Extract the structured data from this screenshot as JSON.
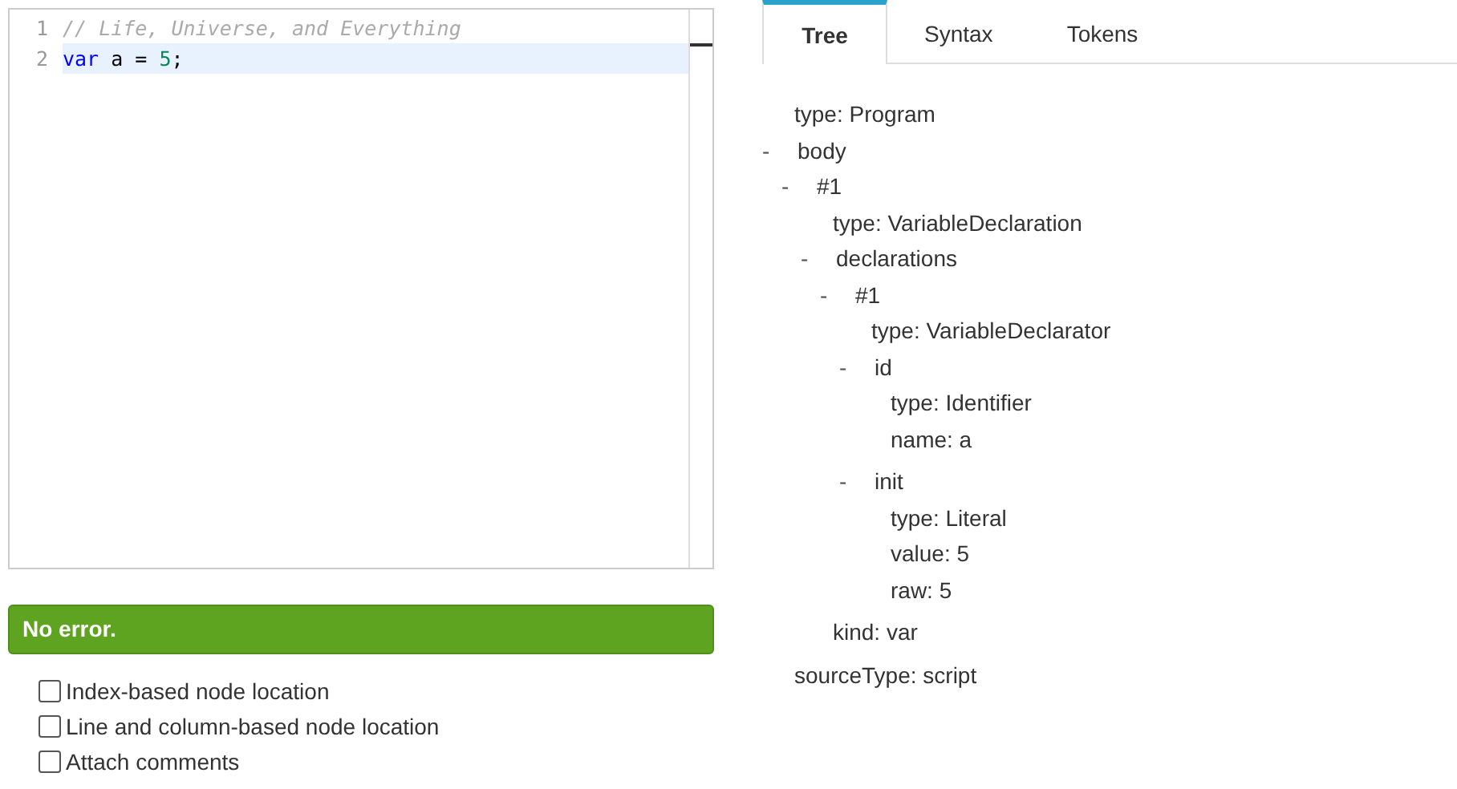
{
  "editor": {
    "lines": [
      {
        "number": "1",
        "active": false,
        "tokens": [
          {
            "kind": "comment",
            "text": "// Life, Universe, and Everything"
          }
        ]
      },
      {
        "number": "2",
        "active": true,
        "tokens": [
          {
            "kind": "keyword",
            "text": "var"
          },
          {
            "kind": "plain",
            "text": " a = "
          },
          {
            "kind": "number",
            "text": "5"
          },
          {
            "kind": "plain",
            "text": ";"
          }
        ]
      }
    ]
  },
  "status": {
    "kind": "ok",
    "text": "No error."
  },
  "options": [
    {
      "label": "Index-based node location",
      "checked": false
    },
    {
      "label": "Line and column-based node location",
      "checked": false
    },
    {
      "label": "Attach comments",
      "checked": false
    }
  ],
  "tabs": [
    {
      "label": "Tree",
      "selected": true
    },
    {
      "label": "Syntax",
      "selected": false
    },
    {
      "label": "Tokens",
      "selected": false
    }
  ],
  "tree": [
    {
      "kind": "prop",
      "text": "type: Program"
    },
    {
      "kind": "group",
      "toggle": "-",
      "label": "body",
      "expanded": true,
      "children": [
        {
          "kind": "group",
          "toggle": "-",
          "label": "#1",
          "expanded": true,
          "children": [
            {
              "kind": "prop",
              "text": "type: VariableDeclaration"
            },
            {
              "kind": "group",
              "toggle": "-",
              "label": "declarations",
              "expanded": true,
              "children": [
                {
                  "kind": "group",
                  "toggle": "-",
                  "label": "#1",
                  "expanded": true,
                  "children": [
                    {
                      "kind": "prop",
                      "text": "type: VariableDeclarator"
                    },
                    {
                      "kind": "group",
                      "toggle": "-",
                      "label": "id",
                      "expanded": true,
                      "children": [
                        {
                          "kind": "prop",
                          "text": "type: Identifier"
                        },
                        {
                          "kind": "prop",
                          "text": "name: a"
                        }
                      ]
                    },
                    {
                      "kind": "group",
                      "toggle": "-",
                      "label": "init",
                      "expanded": true,
                      "children": [
                        {
                          "kind": "prop",
                          "text": "type: Literal"
                        },
                        {
                          "kind": "prop",
                          "text": "value: 5"
                        },
                        {
                          "kind": "prop",
                          "text": "raw: 5"
                        }
                      ]
                    }
                  ]
                }
              ]
            },
            {
              "kind": "prop",
              "text": "kind: var"
            }
          ]
        }
      ]
    },
    {
      "kind": "prop",
      "text": "sourceType: script"
    }
  ]
}
